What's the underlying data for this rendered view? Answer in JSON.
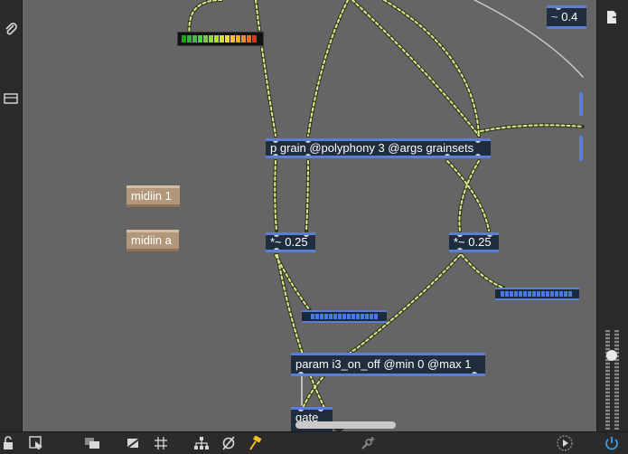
{
  "objects": {
    "grain": "p grain @polyphony 3 @args grainsets",
    "mult_left": "*~ 0.25",
    "mult_right": "*~ 0.25",
    "param": "param i3_on_off @min 0 @max 1",
    "bottom_obj": "gate",
    "signal_value": "0.4"
  },
  "messages": {
    "midiin_1": "midiin 1",
    "midiin_a": "midiin a"
  },
  "colors": {
    "canvas": "#656565",
    "patch_cord": "#dfe88f",
    "object_border": "#5b7fd6",
    "message_box": "#b3977b"
  },
  "toolbar": {
    "left_icons": [
      "paperclip-icon",
      "clipboard-icon"
    ],
    "bottom_icons": [
      "lock-icon",
      "select-pointer-icon",
      "layers-icon",
      "hide-icon",
      "grid-icon",
      "tree-icon",
      "null-icon",
      "pin-icon",
      "add-component-icon",
      "play-icon",
      "power-icon"
    ],
    "right_icons": [
      "export-icon"
    ]
  }
}
